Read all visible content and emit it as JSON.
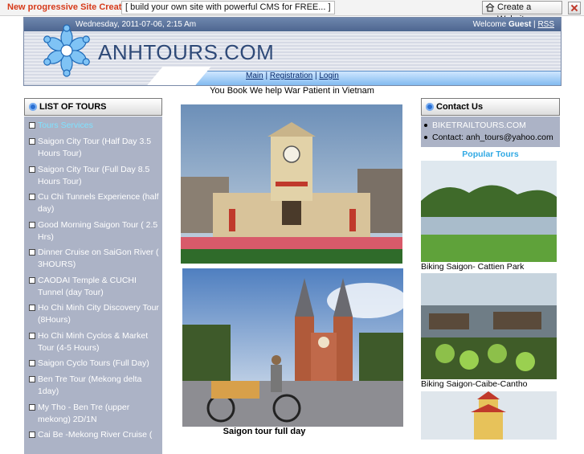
{
  "promo": {
    "title": "New progressive Site Creator",
    "tagline": "[ build your own site with powerful CMS for FREE... ]",
    "create_label": "Create a Website"
  },
  "header": {
    "date": "Wednesday, 2011-07-06, 2:15 Am",
    "welcome_prefix": "Welcome",
    "welcome_user": "Guest",
    "rss": "RSS",
    "site_title": "ANHTOURS.COM",
    "nav": [
      "Main",
      "Registration",
      "Login"
    ]
  },
  "tagline": "You Book We help War Patient in Vietnam",
  "tours": {
    "title": "LIST OF TOURS",
    "items": [
      "Tours Services",
      "Saigon City Tour (Half Day 3.5 Hours Tour)",
      "Saigon City Tour (Full Day 8.5 Hours Tour)",
      "Cu Chi Tunnels Experience (half day)",
      "Good Morning Saigon Tour ( 2.5 Hrs)",
      "Dinner Cruise on SaiGon River ( 3HOURS)",
      "CAODAI Temple & CUCHI Tunnel (day Tour)",
      "Ho Chi Minh City Discovery Tour (8Hours)",
      "Ho Chi Minh Cyclos & Market Tour (4-5 Hours)",
      "Saigon Cyclo Tours (Full Day)",
      "Ben Tre Tour (Mekong delta 1day)",
      "My Tho - Ben Tre (upper mekong) 2D/1N",
      "Cai Be -Mekong River Cruise ("
    ]
  },
  "center": {
    "photo2_caption": "Saigon tour full day"
  },
  "contact": {
    "title": "Contact Us",
    "site": "BIKETRAILTOURS.COM",
    "email": "Contact: anh_tours@yahoo.com"
  },
  "popular": {
    "title": "Popular Tours",
    "items": [
      "Biking Saigon- Cattien Park",
      "Biking Saigon-Caibe-Cantho"
    ]
  },
  "colors": {
    "promo_red": "#d63a1a",
    "sidebar_bg": "#acb3c6",
    "active_link": "#7fe2ff",
    "popular_title": "#30a9e4"
  }
}
